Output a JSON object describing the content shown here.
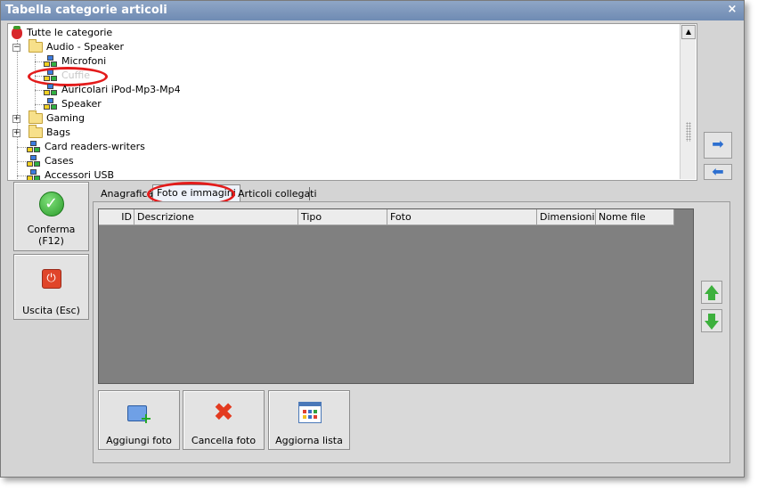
{
  "window": {
    "title": "Tabella categorie articoli",
    "close_glyph": "×"
  },
  "tree": {
    "root": {
      "label": "Tutte le categorie",
      "icon": "strawberry-icon"
    },
    "items": [
      {
        "label": "Audio - Speaker",
        "icon": "folder-icon",
        "expander": "−",
        "level": 1
      },
      {
        "label": "Microfoni",
        "icon": "cubes-icon",
        "level": 2
      },
      {
        "label": "Cuffie",
        "icon": "cubes-icon",
        "level": 2,
        "selected": true
      },
      {
        "label": "Auricolari iPod-Mp3-Mp4",
        "icon": "cubes-icon",
        "level": 2
      },
      {
        "label": "Speaker",
        "icon": "cubes-icon",
        "level": 2
      },
      {
        "label": "Gaming",
        "icon": "folder-icon",
        "expander": "+",
        "level": 1
      },
      {
        "label": "Bags",
        "icon": "folder-icon",
        "expander": "+",
        "level": 1
      },
      {
        "label": "Card readers-writers",
        "icon": "cubes-icon",
        "level": 1
      },
      {
        "label": "Cases",
        "icon": "cubes-icon",
        "level": 1
      },
      {
        "label": "Accessori USB",
        "icon": "cubes-icon",
        "level": 1
      }
    ]
  },
  "commands": {
    "confirm_label": "Conferma",
    "confirm_key": "(F12)",
    "exit_label": "Uscita (Esc)"
  },
  "tabs": [
    {
      "label": "Anagrafica",
      "active": false
    },
    {
      "label": "Foto e immagini",
      "active": true
    },
    {
      "label": "Articoli collegati",
      "active": false
    }
  ],
  "grid": {
    "columns": [
      "ID",
      "Descrizione",
      "Tipo",
      "Foto",
      "Dimensioni",
      "Nome file"
    ],
    "rows": []
  },
  "actions": {
    "add_photo": "Aggiungi foto",
    "delete_photo": "Cancella foto",
    "refresh_list": "Aggiorna lista"
  },
  "colors": {
    "titlebar": "#7f98bd",
    "highlight_ellipse": "#e31b1b",
    "grid_background": "#808080",
    "arrow_green": "#3db03d"
  }
}
